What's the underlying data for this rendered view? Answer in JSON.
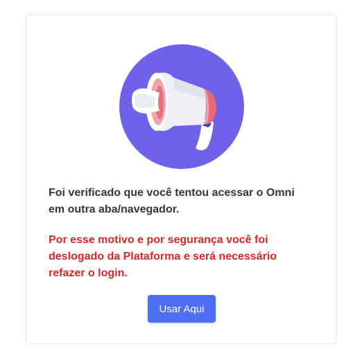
{
  "illustration": {
    "icon": "megaphone-icon",
    "background_color": "#6f62ea"
  },
  "message": {
    "primary": "Foi verificado que você tentou acessar o Omni em outra aba/navegador.",
    "warning": "Por esse motivo e por segurança você foi deslogado da Plataforma e será necessário refazer o login."
  },
  "button": {
    "label": "Usar Aqui",
    "color": "#4f6ef6"
  },
  "colors": {
    "primary_text": "#2f3542",
    "warning_text": "#dc2626"
  }
}
